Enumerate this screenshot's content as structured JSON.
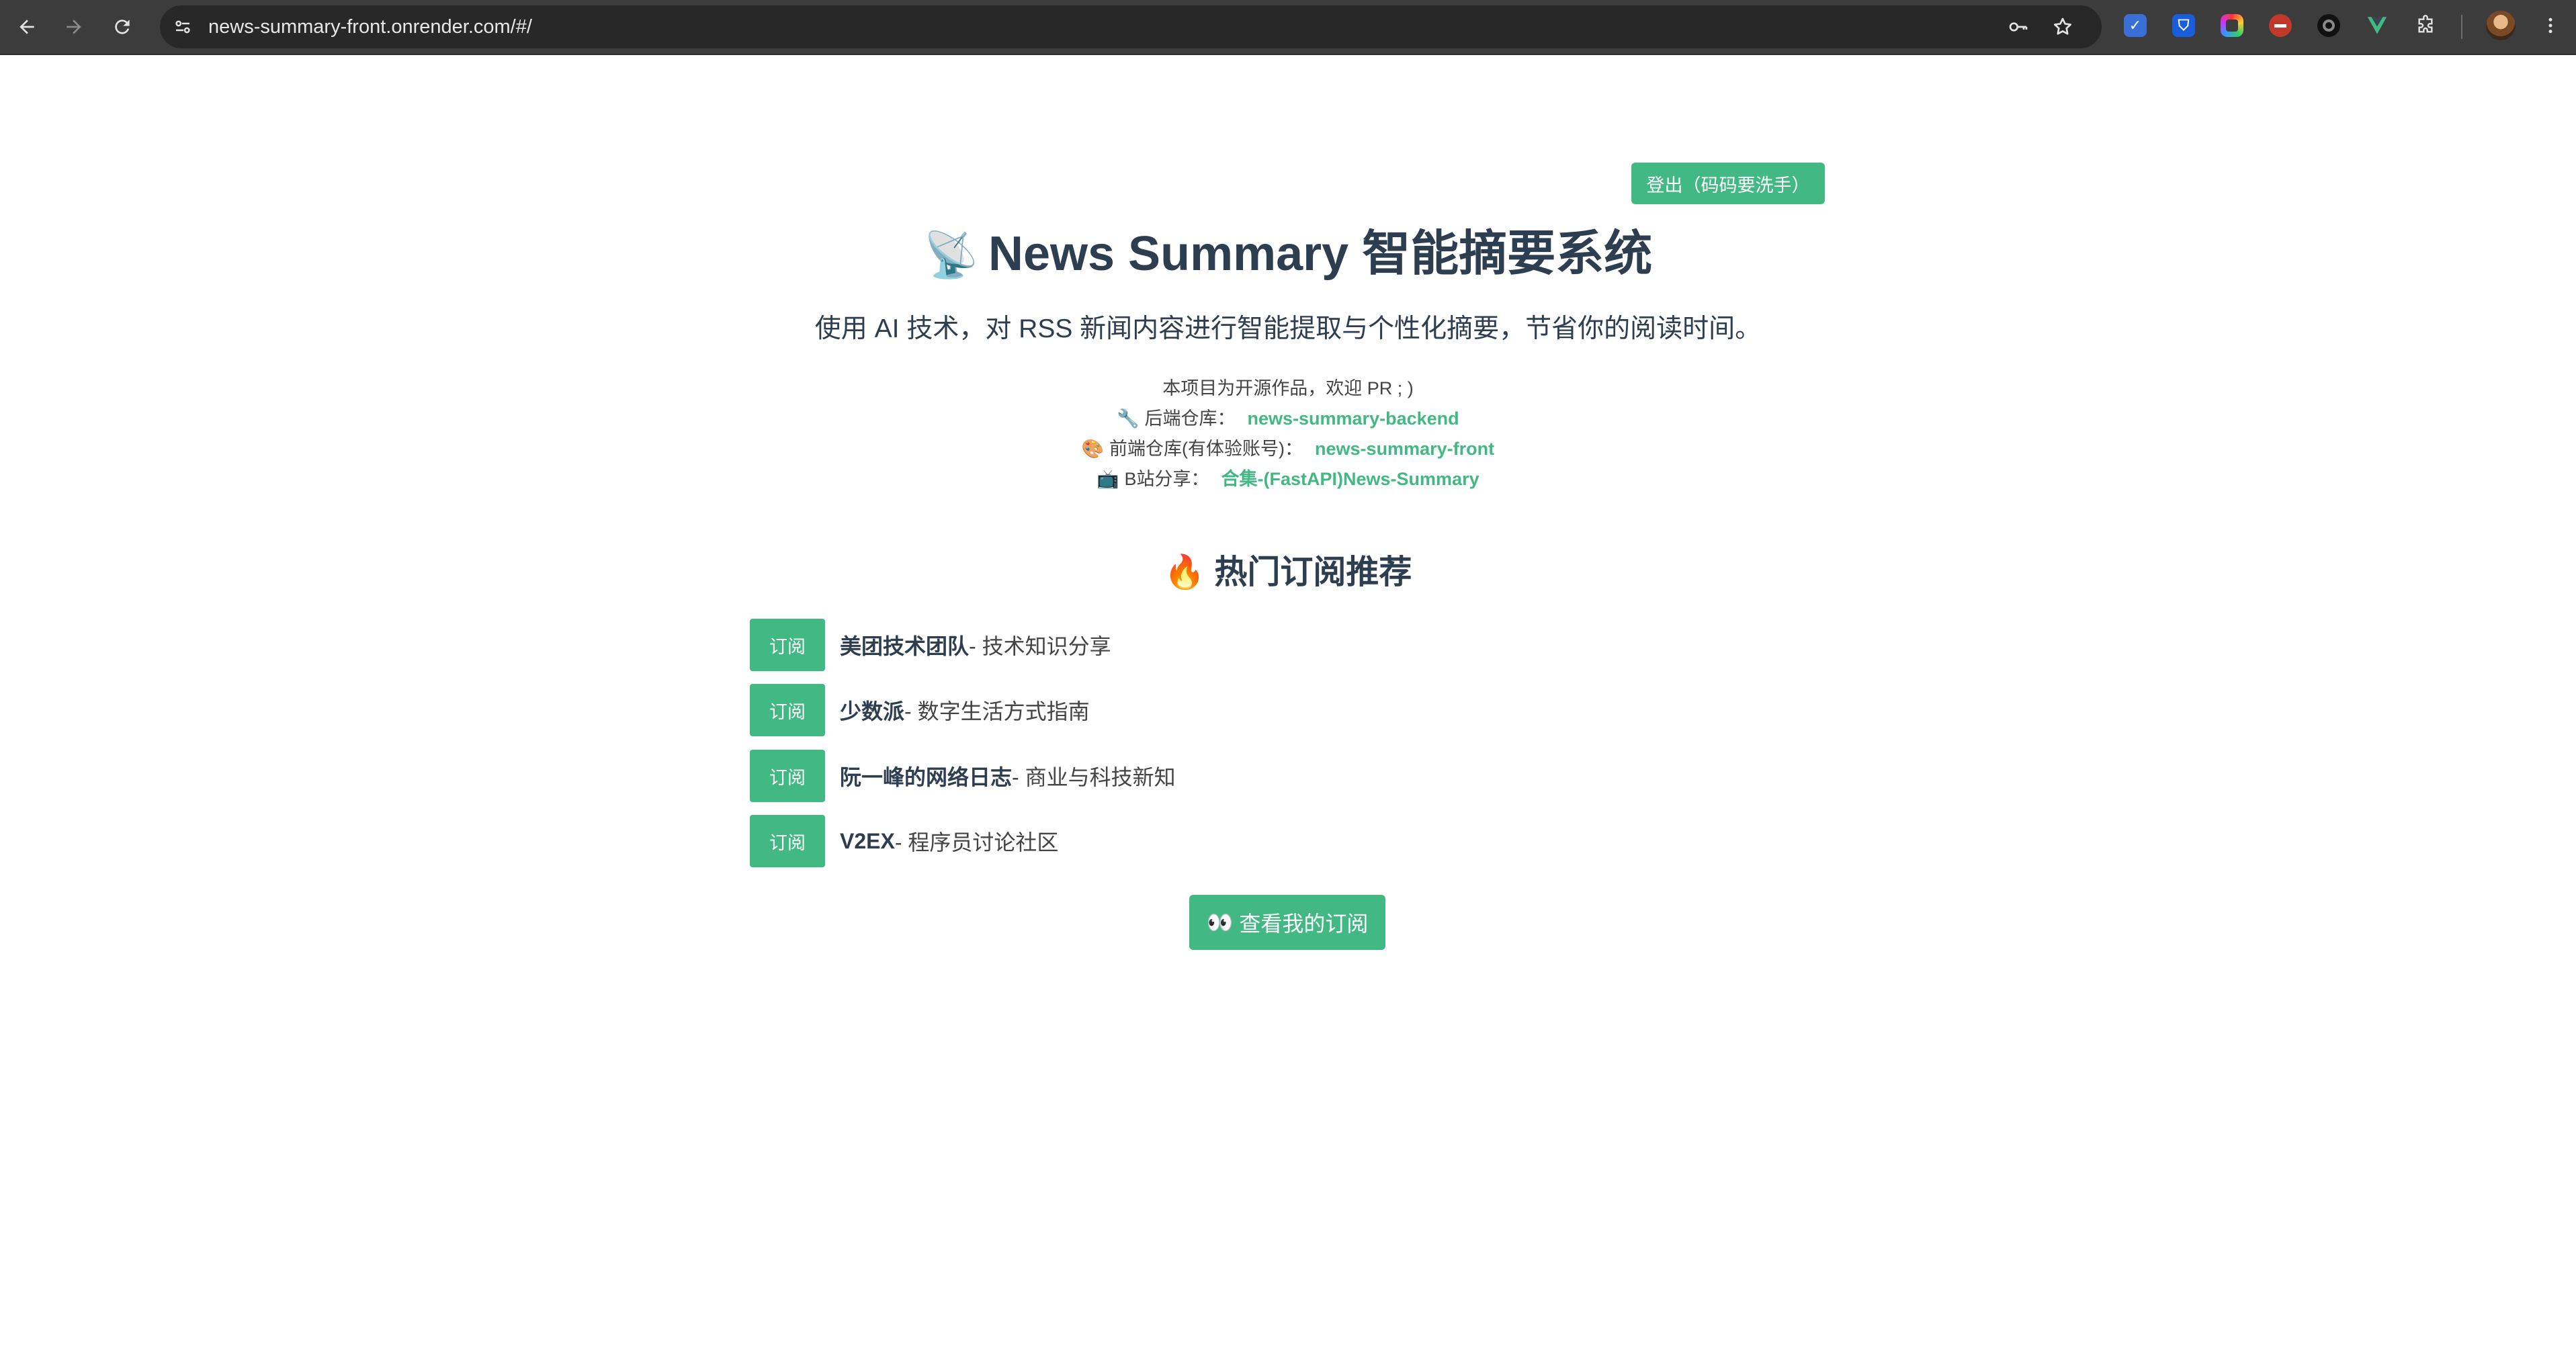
{
  "browser": {
    "url": "news-summary-front.onrender.com/#/"
  },
  "header": {
    "logout_label": "登出（码码要洗手）"
  },
  "hero": {
    "title_icon": "📡",
    "title": "News Summary 智能摘要系统",
    "subtitle": "使用 AI 技术，对 RSS 新闻内容进行智能提取与个性化摘要，节省你的阅读时间。"
  },
  "info": {
    "open_source_note": "本项目为开源作品，欢迎 PR ; )",
    "backend": {
      "icon": "🔧",
      "label": "后端仓库：",
      "link": "news-summary-backend"
    },
    "frontend": {
      "icon": "🎨",
      "label": "前端仓库(有体验账号)：",
      "link": "news-summary-front"
    },
    "bilibili": {
      "icon": "📺",
      "label": "B站分享：",
      "link": "合集-(FastAPI)News-Summary"
    }
  },
  "recommend": {
    "icon": "🔥",
    "title": "热门订阅推荐",
    "feeds": [
      {
        "button": "订阅",
        "name": "美团技术团队",
        "desc": " - 技术知识分享"
      },
      {
        "button": "订阅",
        "name": "少数派",
        "desc": " - 数字生活方式指南"
      },
      {
        "button": "订阅",
        "name": "阮一峰的网络日志",
        "desc": " - 商业与科技新知"
      },
      {
        "button": "订阅",
        "name": "V2EX",
        "desc": " - 程序员讨论社区"
      }
    ]
  },
  "actions": {
    "view_icon": "👀",
    "view_label": "查看我的订阅"
  },
  "colors": {
    "accent": "#42b883",
    "text": "#2c3e50",
    "chrome": "#3c3c3c"
  }
}
